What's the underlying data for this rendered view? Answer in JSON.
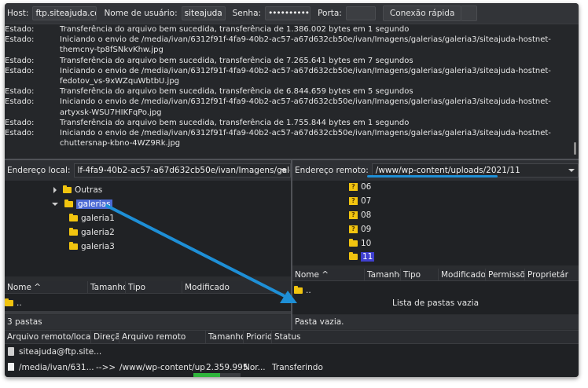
{
  "quickconnect": {
    "host_label": "Host:",
    "host_value": "ftp.siteajuda.com",
    "user_label": "Nome de usuário:",
    "user_value": "siteajuda",
    "pass_label": "Senha:",
    "pass_value": "••••••••••••••",
    "port_label": "Porta:",
    "port_value": "",
    "connect_button": "Conexão rápida"
  },
  "log": [
    {
      "key": "Estado:",
      "text": "Transferência do arquivo bem sucedida, transferência de 1.386.002 bytes em 1 segundo"
    },
    {
      "key": "Estado:",
      "text": "Iniciando o envio de /media/ivan/6312f91f-4fa9-40b2-ac57-a67d632cb50e/ivan/Imagens/galerias/galeria3/siteajuda-hostnet-themcny-tp8fSNkvKhw.jpg"
    },
    {
      "key": "Estado:",
      "text": "Transferência do arquivo bem sucedida, transferência de 7.265.641 bytes em 7 segundos"
    },
    {
      "key": "Estado:",
      "text": "Iniciando o envio de /media/ivan/6312f91f-4fa9-40b2-ac57-a67d632cb50e/ivan/Imagens/galerias/galeria3/siteajuda-hostnet-fedotov_vs-9xWZquWbtbU.jpg"
    },
    {
      "key": "Estado:",
      "text": "Transferência do arquivo bem sucedida, transferência de 6.844.659 bytes em 5 segundos"
    },
    {
      "key": "Estado:",
      "text": "Iniciando o envio de /media/ivan/6312f91f-4fa9-40b2-ac57-a67d632cb50e/ivan/Imagens/galerias/galeria3/siteajuda-hostnet-artyxsk-WSU7HIKFqPo.jpg"
    },
    {
      "key": "Estado:",
      "text": "Transferência do arquivo bem sucedida, transferência de 1.755.844 bytes em 1 segundo"
    },
    {
      "key": "Estado:",
      "text": "Iniciando o envio de /media/ivan/6312f91f-4fa9-40b2-ac57-a67d632cb50e/ivan/Imagens/galerias/galeria3/siteajuda-hostnet-chuttersnap-kbno-4WZ9Rk.jpg"
    }
  ],
  "local": {
    "address_label": "Endereço local:",
    "address_value": "lf-4fa9-40b2-ac57-a67d632cb50e/ivan/Imagens/galerias/",
    "tree": [
      {
        "label": "Outras"
      },
      {
        "label": "galerias"
      },
      {
        "label": "galeria1"
      },
      {
        "label": "galeria2"
      },
      {
        "label": "galeria3"
      }
    ],
    "columns": [
      "Nome ^",
      "Tamanho",
      "Tipo",
      "Modificado"
    ],
    "rows": [
      {
        "name": ".."
      }
    ],
    "status": "3 pastas"
  },
  "remote": {
    "address_label": "Endereço remoto:",
    "address_value": "/www/wp-content/uploads/2021/11",
    "tree": [
      {
        "label": "06"
      },
      {
        "label": "07"
      },
      {
        "label": "08"
      },
      {
        "label": "09"
      },
      {
        "label": "10"
      },
      {
        "label": "11"
      }
    ],
    "columns": [
      "Nome ^",
      "Tamanho",
      "Tipo",
      "Modificado",
      "Permissõ",
      "Proprietár"
    ],
    "rows": [
      {
        "name": ".."
      }
    ],
    "empty_text": "Lista de pastas vazia",
    "status": "Pasta vazia."
  },
  "queue": {
    "columns": [
      "Arquivo remoto/local",
      "Direção",
      "Arquivo remoto",
      "Tamanho",
      "Priorid.",
      "Status"
    ],
    "server": "siteajuda@ftp.site...",
    "item": {
      "local": "/media/ivan/631...",
      "direction": "-->>",
      "remote": "/www/wp-content/up...",
      "size": "2.359.995",
      "priority": "Nor...",
      "status": "Transferindo"
    },
    "progress": 0.56
  },
  "colors": {
    "annotation_arrow": "#1e8fd6",
    "selection": "#4c6ad4"
  }
}
